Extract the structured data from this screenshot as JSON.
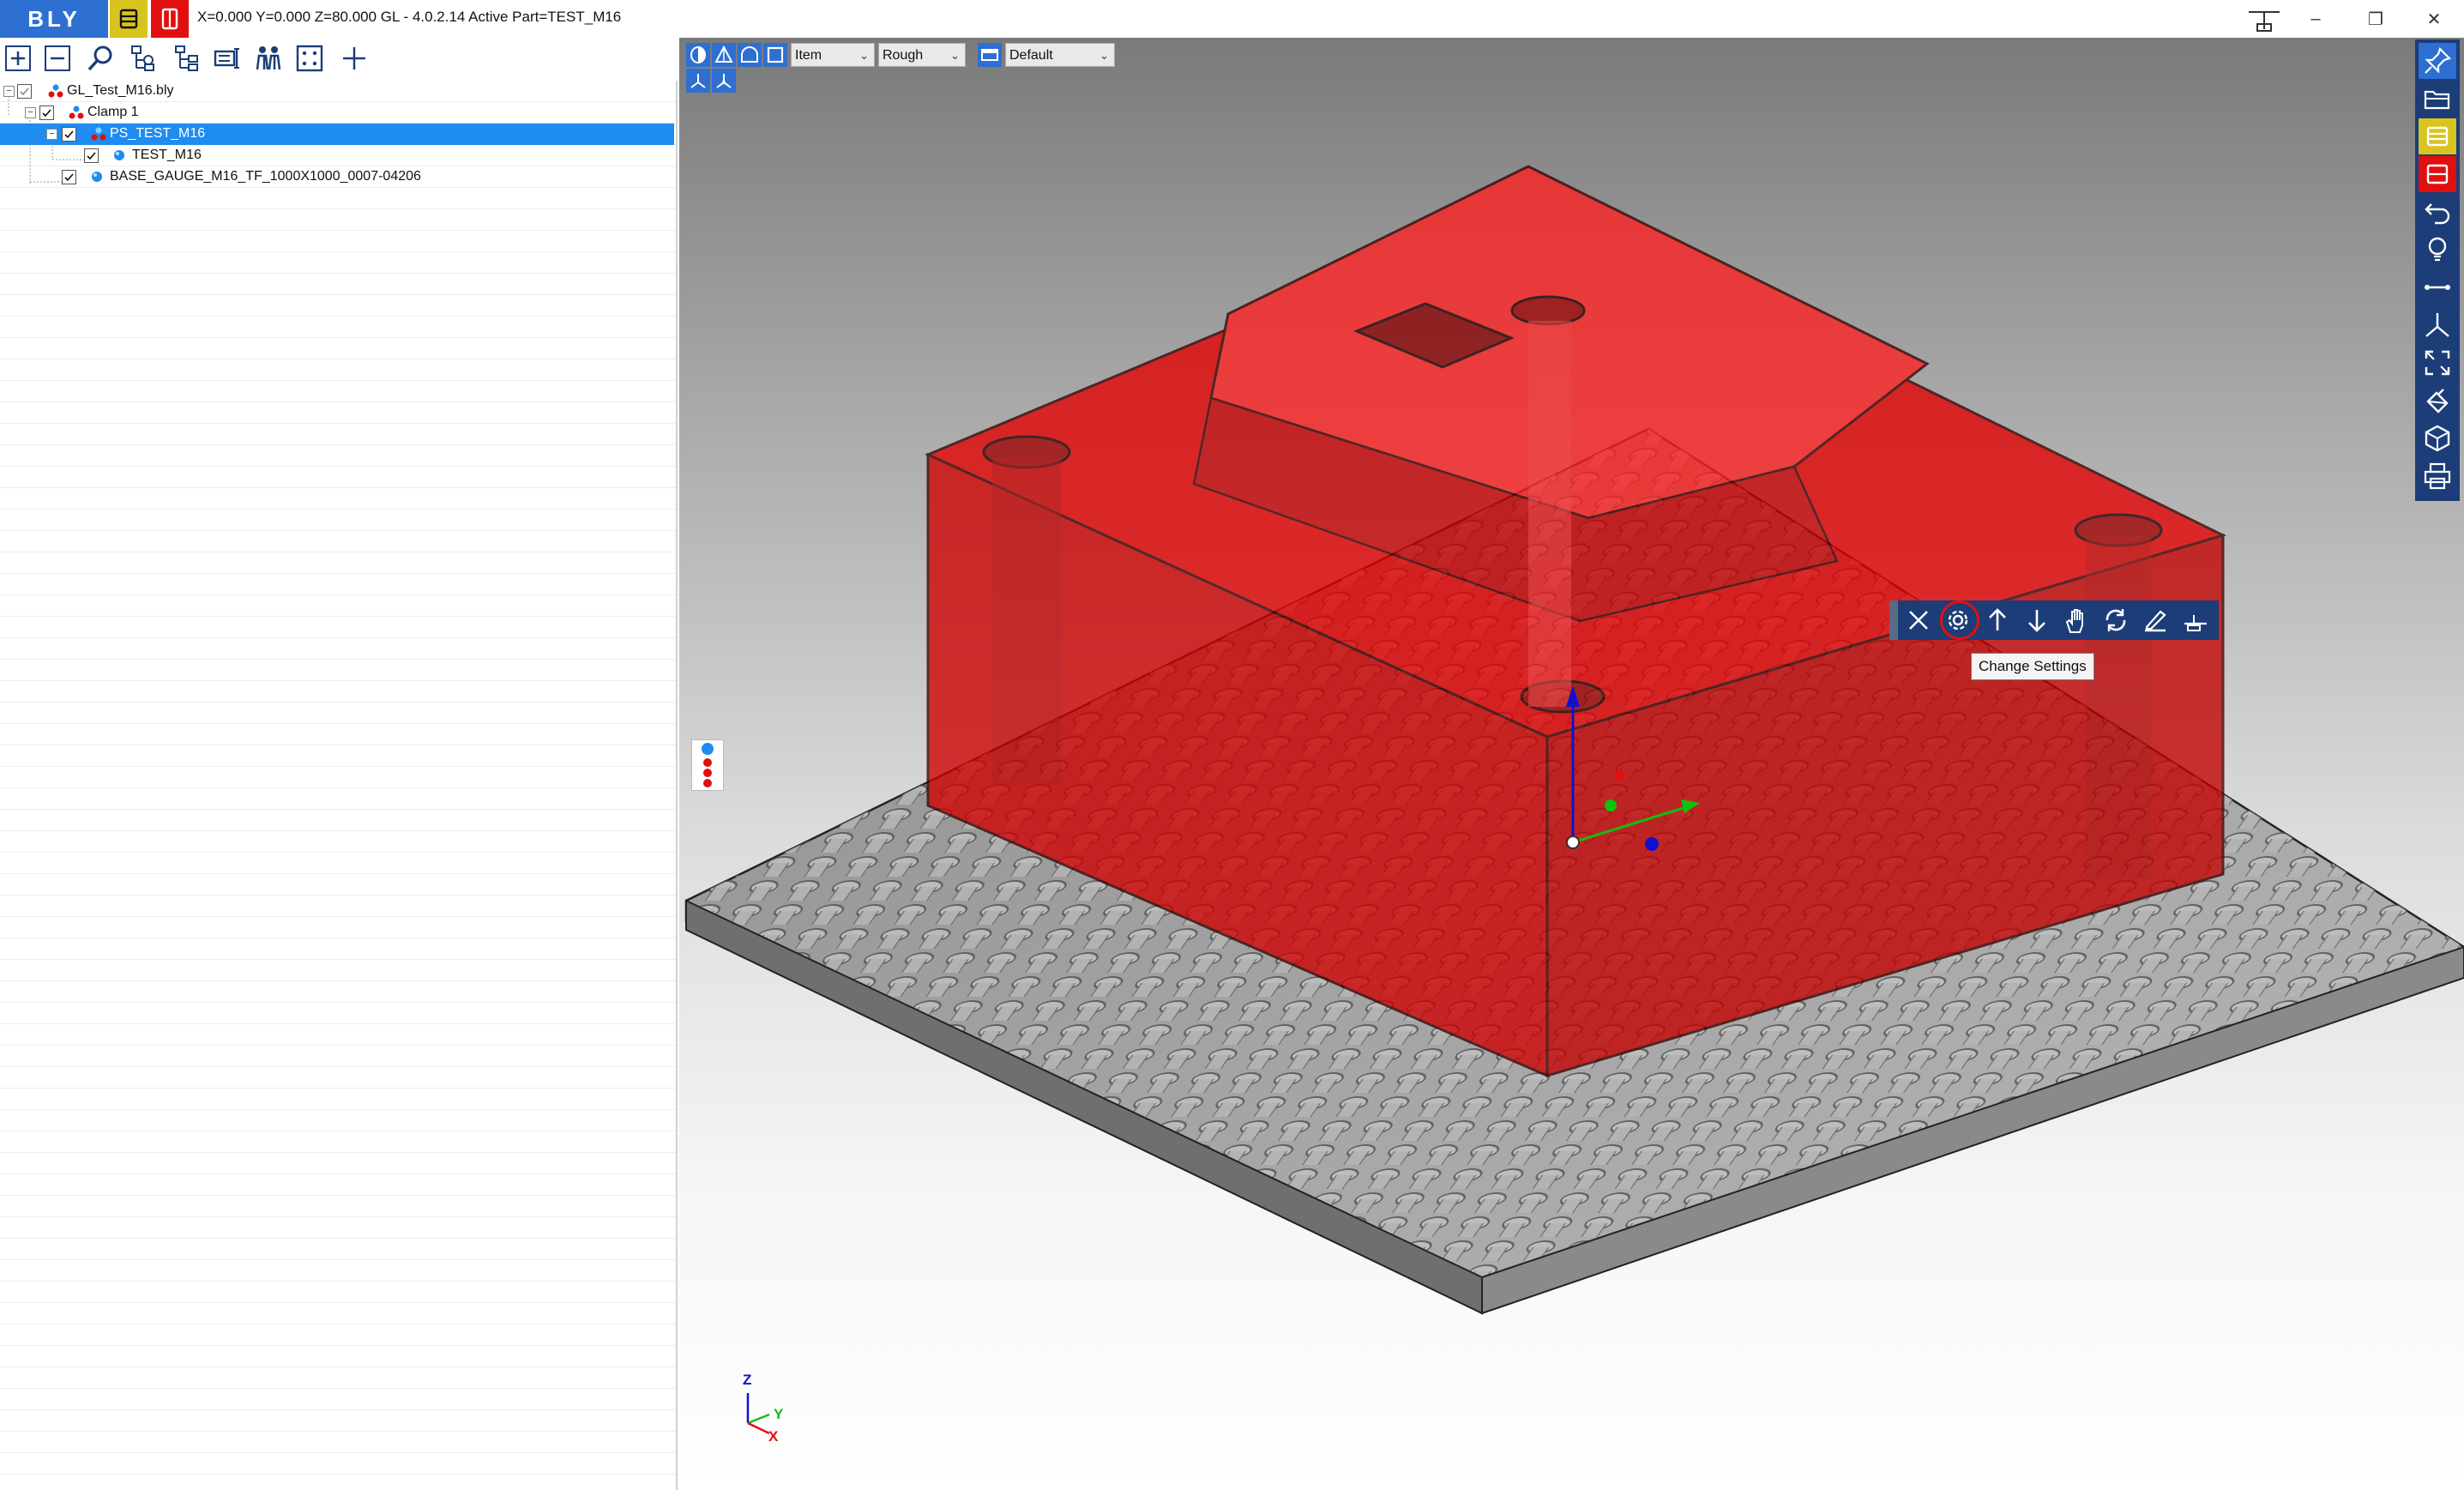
{
  "app": {
    "logo_text": "BLY",
    "status_line": "X=0.000 Y=0.000 Z=80.000   GL - 4.0.2.14 Active Part=TEST_M16",
    "window_controls": [
      "–",
      "❐",
      "✕"
    ]
  },
  "colors": {
    "brand_blue": "#2e6fd2",
    "toolbar_navy": "#1c3d78",
    "selection_blue": "#1e8cf0",
    "accent_yellow": "#d8c41e",
    "accent_red": "#e01010",
    "part_red": "#e00000"
  },
  "title_icons": [
    "gauge-yellow-icon",
    "gauge-red-icon"
  ],
  "tree_toolbar": [
    "expand-all-icon",
    "collapse-all-icon",
    "find-icon",
    "tree-structure-icon",
    "tree-branch-icon",
    "properties-icon",
    "users-icon",
    "fit-selection-icon",
    "add-icon"
  ],
  "tree": {
    "items": [
      {
        "label": "GL_Test_M16.bly",
        "level": 0,
        "expander": "−",
        "checked": true,
        "icon": "assembly-icon"
      },
      {
        "label": "Clamp 1",
        "level": 1,
        "expander": "−",
        "checked": true,
        "icon": "clamp-icon"
      },
      {
        "label": "PS_TEST_M16",
        "level": 2,
        "expander": "−",
        "checked": true,
        "icon": "part-set-icon",
        "selected": true
      },
      {
        "label": "TEST_M16",
        "level": 3,
        "expander": "",
        "checked": true,
        "icon": "part-icon"
      },
      {
        "label": "BASE_GAUGE_M16_TF_1000X1000_0007-04206",
        "level": 2,
        "expander": "",
        "checked": true,
        "icon": "part-icon"
      }
    ]
  },
  "viewport": {
    "view_icons": [
      "shaded-icon",
      "wireframe-icon",
      "hidden-line-icon",
      "outline-icon"
    ],
    "combo_item": "Item",
    "combo_quality": "Rough",
    "combo_view": "Default",
    "view_toggle_icons": [
      "axis-xyz-icon",
      "axis-plane-icon"
    ],
    "right_toolbar": [
      "pin-icon",
      "open-folder-icon",
      "gauge-yellow-icon",
      "gauge-red-icon",
      "undo-icon",
      "lightbulb-icon",
      "measure-icon",
      "coordinate-axis-icon",
      "fit-all-icon",
      "paint-bucket-icon",
      "cube-icon",
      "print-icon"
    ],
    "context_toolbar": [
      "close-icon",
      "gear-icon",
      "arrow-up-icon",
      "arrow-down-icon",
      "hand-icon",
      "rotate-icon",
      "edit-icon",
      "gauge-small-icon"
    ],
    "tooltip": "Change Settings",
    "axis_labels": {
      "z": "Z",
      "y": "Y",
      "x": "X"
    }
  }
}
